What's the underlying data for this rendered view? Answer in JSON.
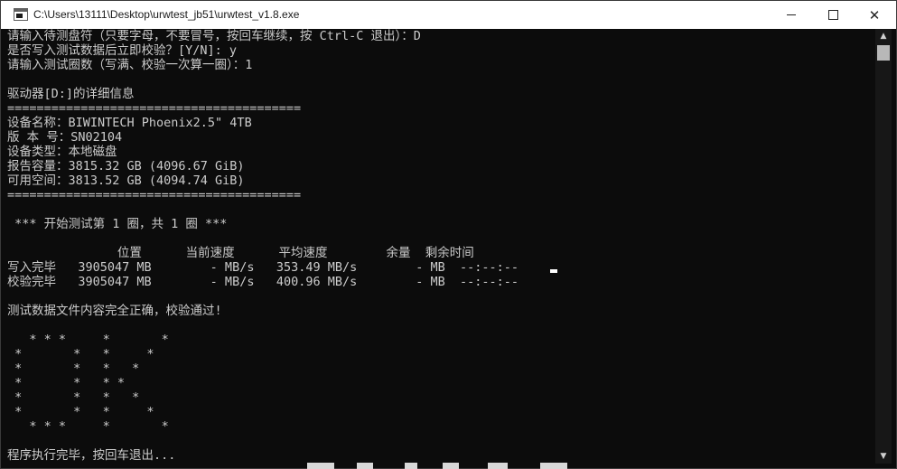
{
  "window": {
    "title": "C:\\Users\\13111\\Desktop\\urwtest_jb51\\urwtest_v1.8.exe",
    "controls": {
      "minimize": "–",
      "maximize": "□",
      "close": "✕"
    }
  },
  "console": {
    "lines": [
      "请输入待测盘符（只要字母，不要冒号，按回车继续，按 Ctrl-C 退出）：D",
      "是否写入测试数据后立即校验？[Y/N]: y",
      "请输入测试圈数（写满、校验一次算一圈）：1",
      "",
      "驱动器[D:]的详细信息",
      "========================================",
      "设备名称：BIWINTECH Phoenix2.5\" 4TB",
      "版 本 号：SN02104",
      "设备类型：本地磁盘",
      "报告容量：3815.32 GB (4096.67 GiB)",
      "可用空间：3813.52 GB (4094.74 GiB)",
      "========================================",
      "",
      " *** 开始测试第 1 圈，共 1 圈 ***",
      "",
      "               位置      当前速度      平均速度        余量  剩余时间",
      "写入完毕   3905047 MB        - MB/s   353.49 MB/s        - MB  --:--:--",
      "校验完毕   3905047 MB        - MB/s   400.96 MB/s        - MB  --:--:--",
      "",
      "测试数据文件内容完全正确，校验通过!",
      "",
      "   * * *     *       *",
      " *       *   *     *",
      " *       *   *   *",
      " *       *   * *",
      " *       *   *   *",
      " *       *   *     *",
      "   * * *     *       *",
      "",
      "程序执行完毕，按回车退出..."
    ]
  },
  "scrollbar": {
    "up_arrow": "▲",
    "down_arrow": "▼"
  },
  "colors": {
    "background": "#0c0c0c",
    "text": "#cccccc",
    "titlebar": "#ffffff"
  }
}
